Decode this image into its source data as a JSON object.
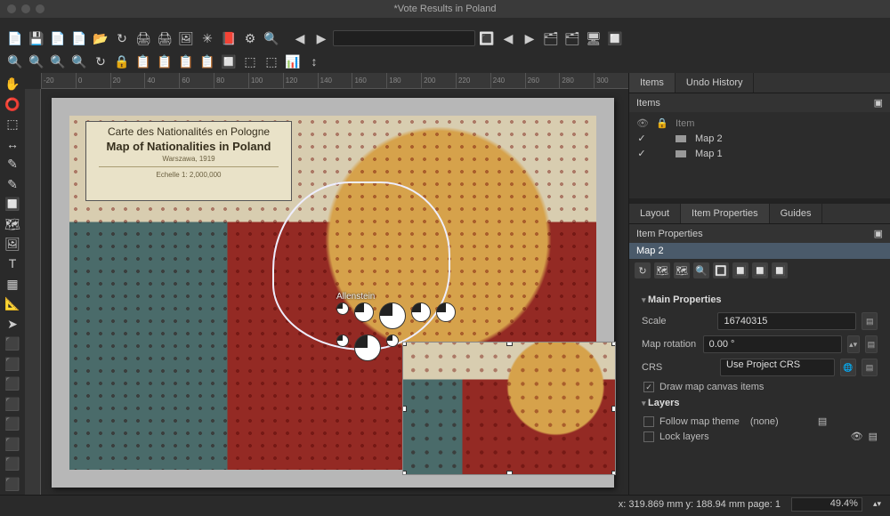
{
  "window": {
    "title": "*Vote Results in Poland"
  },
  "map_legend": {
    "line1": "Carte des Nationalités en Pologne",
    "line2": "Map of Nationalities in Poland",
    "line3": "Warszawa, 1919",
    "line4": "Echelle 1: 2,000,000"
  },
  "city_label": "Allenstein",
  "tabs_top": {
    "items": "Items",
    "undo": "Undo History"
  },
  "items_panel": {
    "header": "Items",
    "cols": {
      "vis": "👁",
      "lock": "🔒",
      "item": "Item"
    },
    "rows": [
      {
        "visible": "✓",
        "locked": "",
        "name": "Map 2"
      },
      {
        "visible": "✓",
        "locked": "",
        "name": "Map 1"
      }
    ]
  },
  "tabs_bottom": {
    "layout": "Layout",
    "props": "Item Properties",
    "guides": "Guides"
  },
  "item_props": {
    "header": "Item Properties",
    "current": "Map 2",
    "main_group": "Main Properties",
    "scale_label": "Scale",
    "scale_value": "16740315",
    "rotation_label": "Map rotation",
    "rotation_value": "0.00 °",
    "crs_label": "CRS",
    "crs_value": "Use Project CRS",
    "draw_canvas": "Draw map canvas items",
    "layers_group": "Layers",
    "follow_theme": "Follow map theme",
    "follow_value": "(none)",
    "lock_layers": "Lock layers"
  },
  "status": {
    "coords": "x: 319.869 mm  y: 188.94 mm  page: 1",
    "zoom": "49.4%"
  },
  "ruler_ticks": [
    "-20",
    "0",
    "20",
    "40",
    "60",
    "80",
    "100",
    "120",
    "140",
    "160",
    "180",
    "200",
    "220",
    "240",
    "260",
    "280",
    "300"
  ],
  "toolbar_icons": [
    "📄",
    "💾",
    "📄",
    "📄",
    "📂",
    "↻",
    "🖨",
    "🖨",
    "🖼",
    "✳",
    "📕",
    "⚙",
    "🔍",
    "|",
    "◀",
    "▶",
    "input",
    "🔳",
    "◀",
    "▶",
    "🗂",
    "🗂",
    "🖥",
    "🔲"
  ],
  "toolbar2_icons": [
    "🔍",
    "🔍",
    "🔍",
    "🔍",
    "↻",
    "🔒",
    "📋",
    "📋",
    "📋",
    "📋",
    "🔲",
    "⬚",
    "⬚",
    "📊",
    "↕"
  ],
  "left_icons": [
    "✋",
    "⭕",
    "⬚",
    "↔",
    "✎",
    "✎",
    "🔲",
    "🗺",
    "🖼",
    "T",
    "▦",
    "📐",
    "➤",
    "⬛",
    "⬛",
    "⬛",
    "⬛",
    "⬛",
    "⬛",
    "⬛",
    "⬛"
  ],
  "mini_tb": [
    "↻",
    "🗺",
    "🗺",
    "🔍",
    "🔳",
    "🔲",
    "🔲",
    "🔲"
  ]
}
